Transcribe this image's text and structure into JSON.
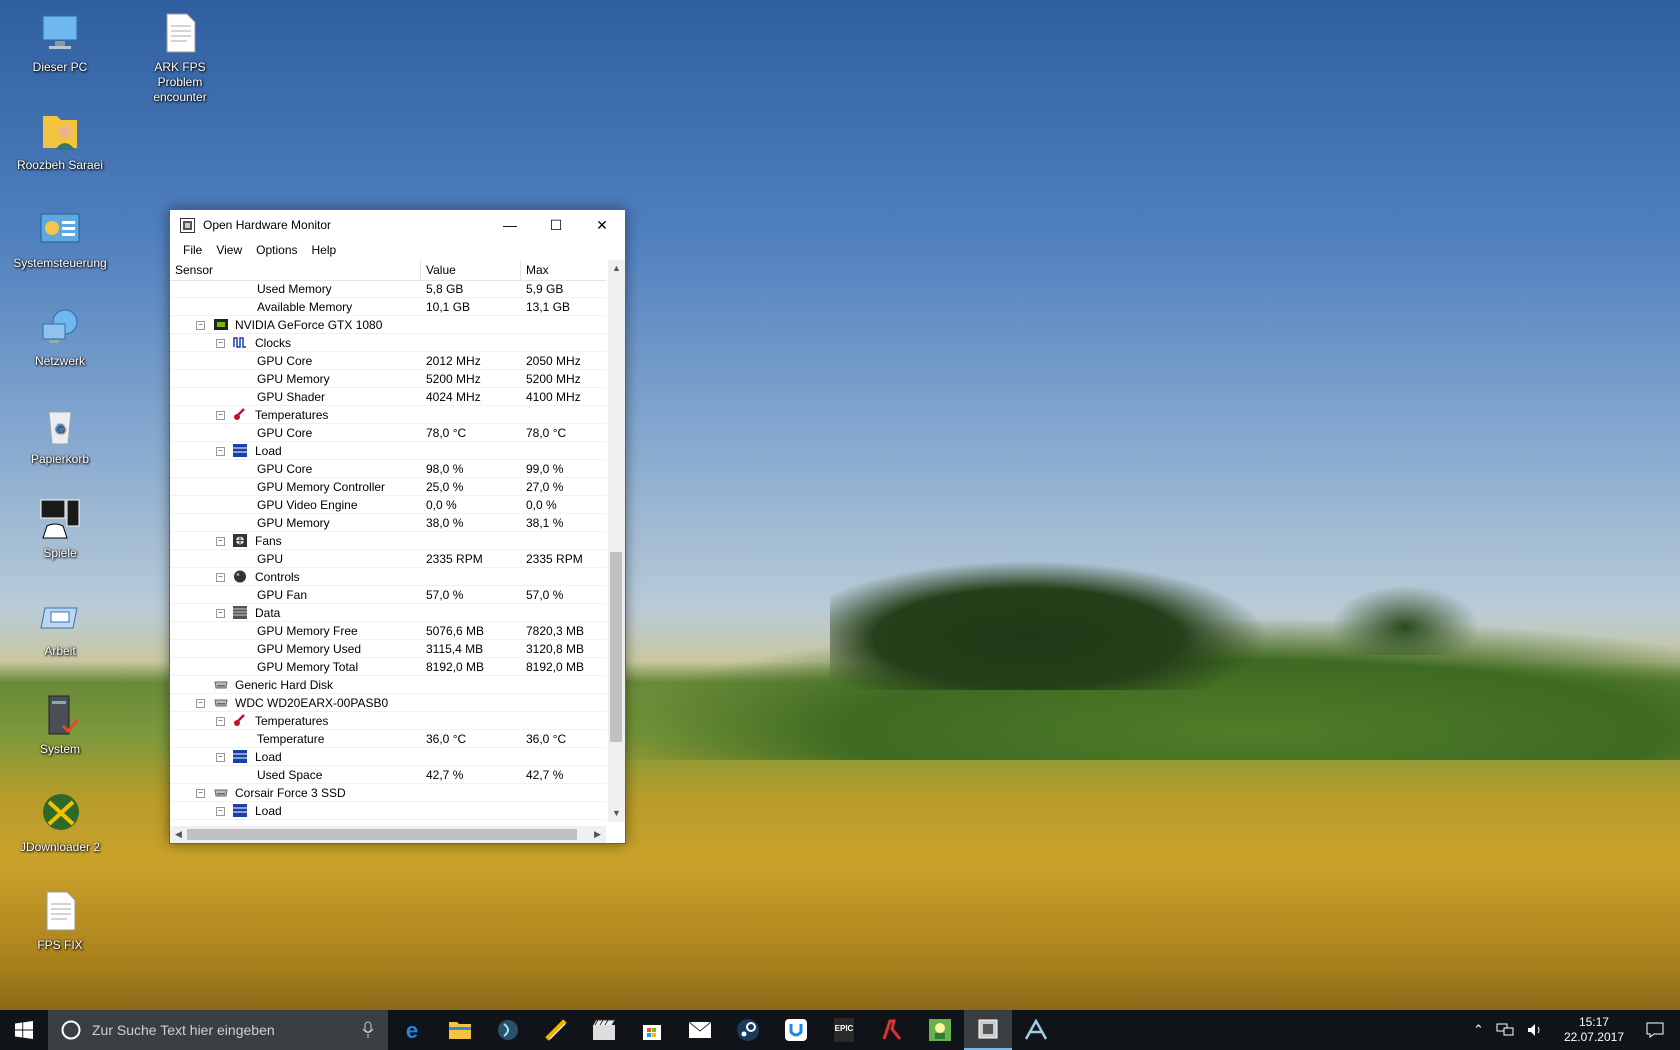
{
  "desktop": {
    "icons": [
      {
        "label": "Dieser PC"
      },
      {
        "label": "ARK FPS Problem encounter"
      },
      {
        "label": "Roozbeh Saraei"
      },
      {
        "label": "Systemsteuerung"
      },
      {
        "label": "Netzwerk"
      },
      {
        "label": "Papierkorb"
      },
      {
        "label": "Spiele"
      },
      {
        "label": "Arbeit"
      },
      {
        "label": "System"
      },
      {
        "label": "JDownloader 2"
      },
      {
        "label": "FPS FIX"
      }
    ]
  },
  "window": {
    "title": "Open Hardware Monitor",
    "menu": [
      "File",
      "View",
      "Options",
      "Help"
    ],
    "columns": [
      "Sensor",
      "Value",
      "Max"
    ],
    "rows": [
      {
        "name": "Used Memory",
        "value": "5,8 GB",
        "max": "5,9 GB"
      },
      {
        "name": "Available Memory",
        "value": "10,1 GB",
        "max": "13,1 GB"
      },
      {
        "name": "NVIDIA GeForce GTX 1080",
        "value": "",
        "max": ""
      },
      {
        "name": "Clocks",
        "value": "",
        "max": ""
      },
      {
        "name": "GPU Core",
        "value": "2012 MHz",
        "max": "2050 MHz"
      },
      {
        "name": "GPU Memory",
        "value": "5200 MHz",
        "max": "5200 MHz"
      },
      {
        "name": "GPU Shader",
        "value": "4024 MHz",
        "max": "4100 MHz"
      },
      {
        "name": "Temperatures",
        "value": "",
        "max": ""
      },
      {
        "name": "GPU Core",
        "value": "78,0 °C",
        "max": "78,0 °C"
      },
      {
        "name": "Load",
        "value": "",
        "max": ""
      },
      {
        "name": "GPU Core",
        "value": "98,0 %",
        "max": "99,0 %"
      },
      {
        "name": "GPU Memory Controller",
        "value": "25,0 %",
        "max": "27,0 %"
      },
      {
        "name": "GPU Video Engine",
        "value": "0,0 %",
        "max": "0,0 %"
      },
      {
        "name": "GPU Memory",
        "value": "38,0 %",
        "max": "38,1 %"
      },
      {
        "name": "Fans",
        "value": "",
        "max": ""
      },
      {
        "name": "GPU",
        "value": "2335 RPM",
        "max": "2335 RPM"
      },
      {
        "name": "Controls",
        "value": "",
        "max": ""
      },
      {
        "name": "GPU Fan",
        "value": "57,0 %",
        "max": "57,0 %"
      },
      {
        "name": "Data",
        "value": "",
        "max": ""
      },
      {
        "name": "GPU Memory Free",
        "value": "5076,6 MB",
        "max": "7820,3 MB"
      },
      {
        "name": "GPU Memory Used",
        "value": "3115,4 MB",
        "max": "3120,8 MB"
      },
      {
        "name": "GPU Memory Total",
        "value": "8192,0 MB",
        "max": "8192,0 MB"
      },
      {
        "name": "Generic Hard Disk",
        "value": "",
        "max": ""
      },
      {
        "name": "WDC WD20EARX-00PASB0",
        "value": "",
        "max": ""
      },
      {
        "name": "Temperatures",
        "value": "",
        "max": ""
      },
      {
        "name": "Temperature",
        "value": "36,0 °C",
        "max": "36,0 °C"
      },
      {
        "name": "Load",
        "value": "",
        "max": ""
      },
      {
        "name": "Used Space",
        "value": "42,7 %",
        "max": "42,7 %"
      },
      {
        "name": "Corsair Force 3 SSD",
        "value": "",
        "max": ""
      },
      {
        "name": "Load",
        "value": "",
        "max": ""
      }
    ]
  },
  "taskbar": {
    "search_placeholder": "Zur Suche Text hier eingeben",
    "apps": [
      "edge-icon",
      "explorer-icon",
      "app-icon",
      "tool-icon",
      "media-icon",
      "store-icon",
      "mail-icon",
      "steam-icon",
      "uplay-icon",
      "epic-icon",
      "game-icon",
      "launcher-icon",
      "ohm-icon",
      "ark-icon"
    ],
    "epic_label": "EPIC",
    "time": "15:17",
    "date": "22.07.2017"
  }
}
